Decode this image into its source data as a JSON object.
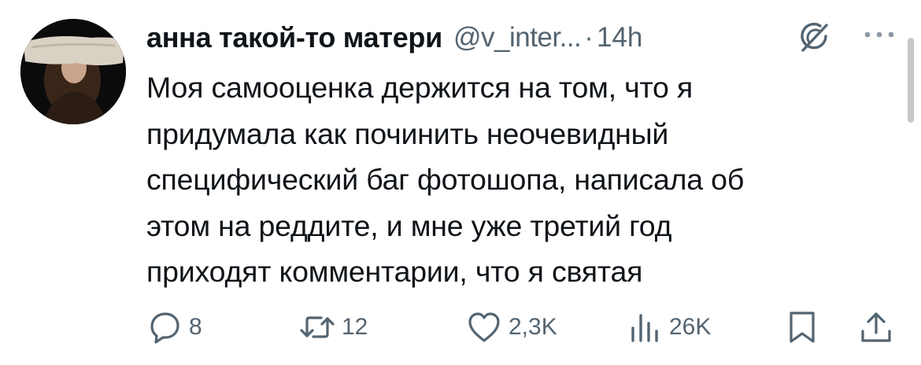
{
  "tweet": {
    "author_name": "анна такой-то матери",
    "handle": "@v_inter...",
    "separator": "·",
    "time": "14h",
    "text_lines": [
      "Моя самооценка держится на том, что я",
      "придумала как починить неочевидный",
      "специфический баг фотошопа, написала об",
      "этом на реддите, и мне уже третий год",
      "приходят комментарии, что я святая"
    ]
  },
  "actions": {
    "reply_count": "8",
    "retweet_count": "12",
    "like_count": "2,3K",
    "views_count": "26K"
  },
  "icons": {
    "avatar": "profile-photo",
    "grok": "grok-icon",
    "more": "more-dots-icon",
    "reply": "reply-icon",
    "retweet": "retweet-icon",
    "like": "heart-icon",
    "views": "views-bar-chart-icon",
    "bookmark": "bookmark-icon",
    "share": "share-icon"
  },
  "colors": {
    "text_primary": "#0f1419",
    "text_secondary": "#536471"
  }
}
